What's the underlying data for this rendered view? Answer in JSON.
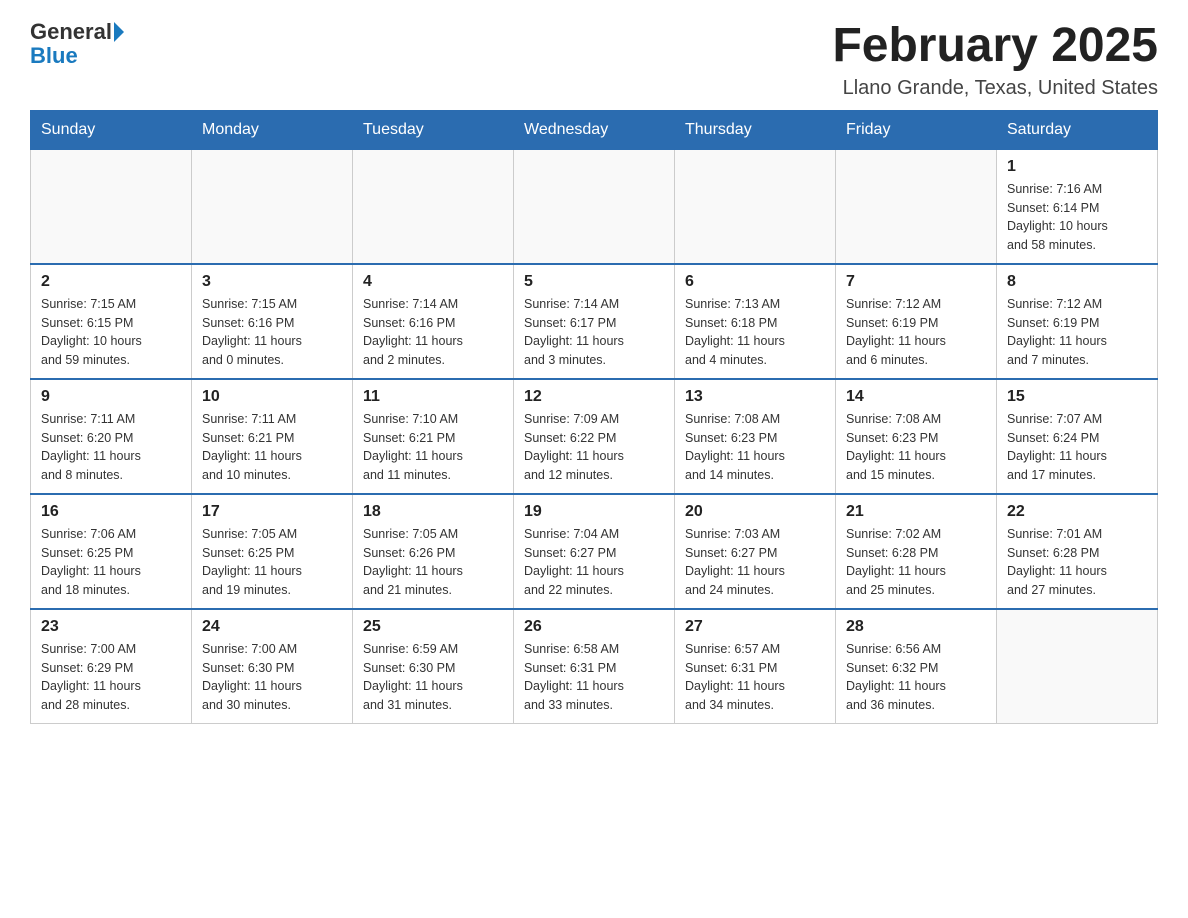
{
  "header": {
    "logo_general": "General",
    "logo_blue": "Blue",
    "month_title": "February 2025",
    "location": "Llano Grande, Texas, United States"
  },
  "days_of_week": [
    "Sunday",
    "Monday",
    "Tuesday",
    "Wednesday",
    "Thursday",
    "Friday",
    "Saturday"
  ],
  "weeks": [
    [
      {
        "day": "",
        "info": ""
      },
      {
        "day": "",
        "info": ""
      },
      {
        "day": "",
        "info": ""
      },
      {
        "day": "",
        "info": ""
      },
      {
        "day": "",
        "info": ""
      },
      {
        "day": "",
        "info": ""
      },
      {
        "day": "1",
        "info": "Sunrise: 7:16 AM\nSunset: 6:14 PM\nDaylight: 10 hours\nand 58 minutes."
      }
    ],
    [
      {
        "day": "2",
        "info": "Sunrise: 7:15 AM\nSunset: 6:15 PM\nDaylight: 10 hours\nand 59 minutes."
      },
      {
        "day": "3",
        "info": "Sunrise: 7:15 AM\nSunset: 6:16 PM\nDaylight: 11 hours\nand 0 minutes."
      },
      {
        "day": "4",
        "info": "Sunrise: 7:14 AM\nSunset: 6:16 PM\nDaylight: 11 hours\nand 2 minutes."
      },
      {
        "day": "5",
        "info": "Sunrise: 7:14 AM\nSunset: 6:17 PM\nDaylight: 11 hours\nand 3 minutes."
      },
      {
        "day": "6",
        "info": "Sunrise: 7:13 AM\nSunset: 6:18 PM\nDaylight: 11 hours\nand 4 minutes."
      },
      {
        "day": "7",
        "info": "Sunrise: 7:12 AM\nSunset: 6:19 PM\nDaylight: 11 hours\nand 6 minutes."
      },
      {
        "day": "8",
        "info": "Sunrise: 7:12 AM\nSunset: 6:19 PM\nDaylight: 11 hours\nand 7 minutes."
      }
    ],
    [
      {
        "day": "9",
        "info": "Sunrise: 7:11 AM\nSunset: 6:20 PM\nDaylight: 11 hours\nand 8 minutes."
      },
      {
        "day": "10",
        "info": "Sunrise: 7:11 AM\nSunset: 6:21 PM\nDaylight: 11 hours\nand 10 minutes."
      },
      {
        "day": "11",
        "info": "Sunrise: 7:10 AM\nSunset: 6:21 PM\nDaylight: 11 hours\nand 11 minutes."
      },
      {
        "day": "12",
        "info": "Sunrise: 7:09 AM\nSunset: 6:22 PM\nDaylight: 11 hours\nand 12 minutes."
      },
      {
        "day": "13",
        "info": "Sunrise: 7:08 AM\nSunset: 6:23 PM\nDaylight: 11 hours\nand 14 minutes."
      },
      {
        "day": "14",
        "info": "Sunrise: 7:08 AM\nSunset: 6:23 PM\nDaylight: 11 hours\nand 15 minutes."
      },
      {
        "day": "15",
        "info": "Sunrise: 7:07 AM\nSunset: 6:24 PM\nDaylight: 11 hours\nand 17 minutes."
      }
    ],
    [
      {
        "day": "16",
        "info": "Sunrise: 7:06 AM\nSunset: 6:25 PM\nDaylight: 11 hours\nand 18 minutes."
      },
      {
        "day": "17",
        "info": "Sunrise: 7:05 AM\nSunset: 6:25 PM\nDaylight: 11 hours\nand 19 minutes."
      },
      {
        "day": "18",
        "info": "Sunrise: 7:05 AM\nSunset: 6:26 PM\nDaylight: 11 hours\nand 21 minutes."
      },
      {
        "day": "19",
        "info": "Sunrise: 7:04 AM\nSunset: 6:27 PM\nDaylight: 11 hours\nand 22 minutes."
      },
      {
        "day": "20",
        "info": "Sunrise: 7:03 AM\nSunset: 6:27 PM\nDaylight: 11 hours\nand 24 minutes."
      },
      {
        "day": "21",
        "info": "Sunrise: 7:02 AM\nSunset: 6:28 PM\nDaylight: 11 hours\nand 25 minutes."
      },
      {
        "day": "22",
        "info": "Sunrise: 7:01 AM\nSunset: 6:28 PM\nDaylight: 11 hours\nand 27 minutes."
      }
    ],
    [
      {
        "day": "23",
        "info": "Sunrise: 7:00 AM\nSunset: 6:29 PM\nDaylight: 11 hours\nand 28 minutes."
      },
      {
        "day": "24",
        "info": "Sunrise: 7:00 AM\nSunset: 6:30 PM\nDaylight: 11 hours\nand 30 minutes."
      },
      {
        "day": "25",
        "info": "Sunrise: 6:59 AM\nSunset: 6:30 PM\nDaylight: 11 hours\nand 31 minutes."
      },
      {
        "day": "26",
        "info": "Sunrise: 6:58 AM\nSunset: 6:31 PM\nDaylight: 11 hours\nand 33 minutes."
      },
      {
        "day": "27",
        "info": "Sunrise: 6:57 AM\nSunset: 6:31 PM\nDaylight: 11 hours\nand 34 minutes."
      },
      {
        "day": "28",
        "info": "Sunrise: 6:56 AM\nSunset: 6:32 PM\nDaylight: 11 hours\nand 36 minutes."
      },
      {
        "day": "",
        "info": ""
      }
    ]
  ]
}
